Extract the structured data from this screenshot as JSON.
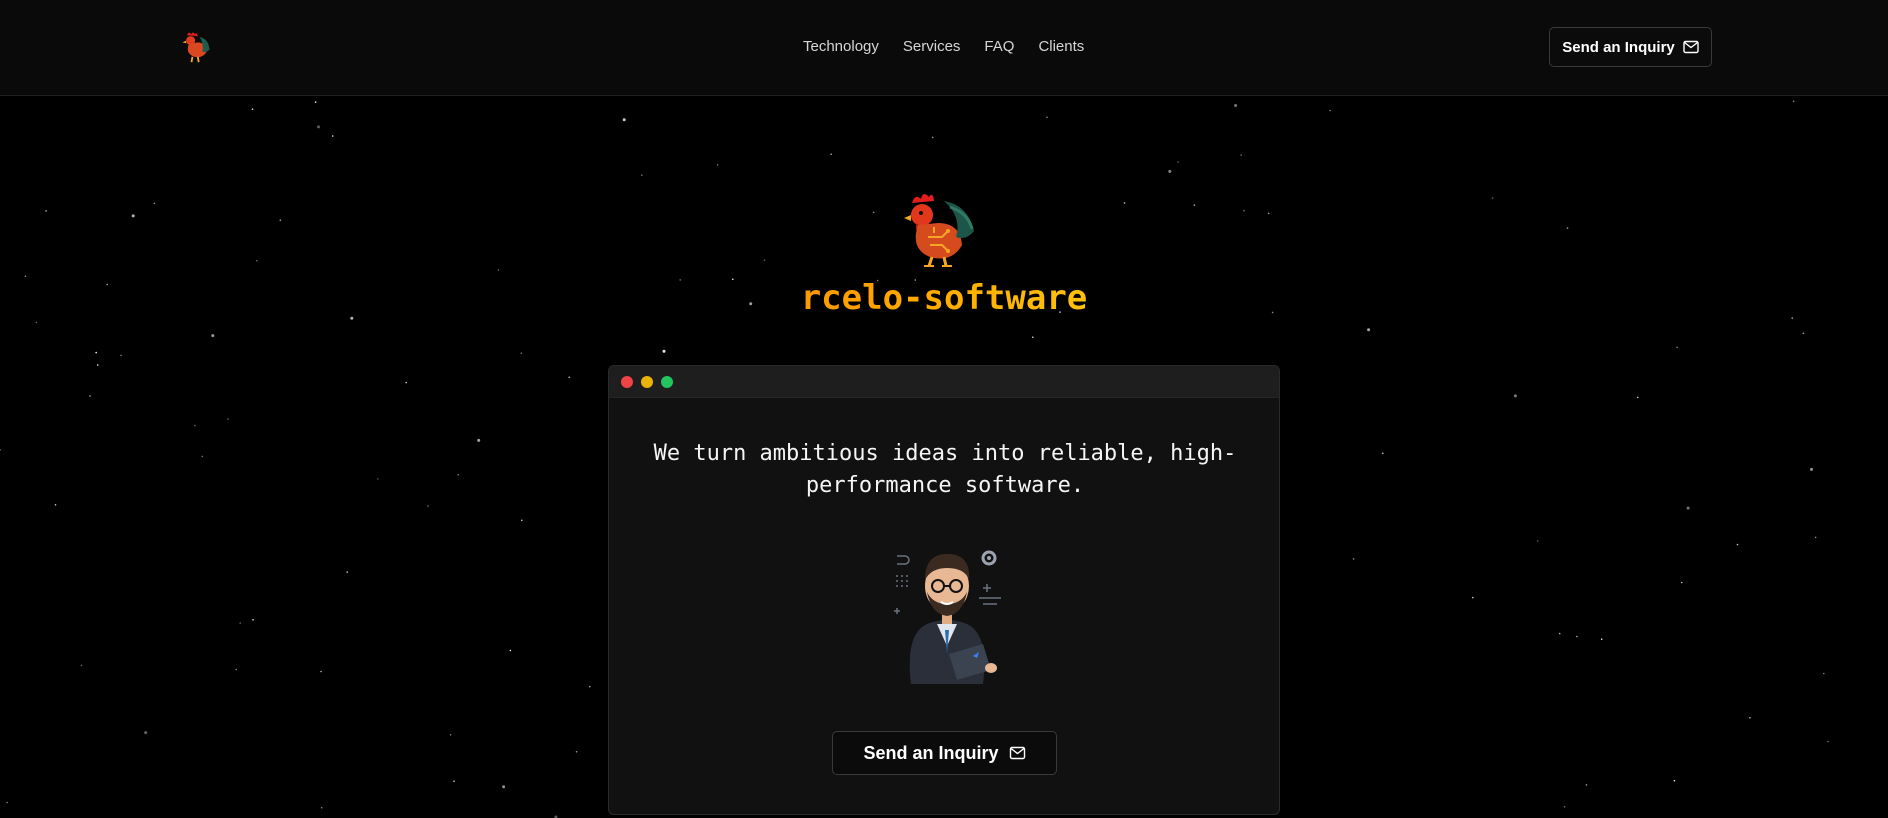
{
  "header": {
    "logo_icon": "rooster-logo-icon",
    "nav": [
      {
        "label": "Technology"
      },
      {
        "label": "Services"
      },
      {
        "label": "FAQ"
      },
      {
        "label": "Clients"
      }
    ],
    "cta_label": "Send an Inquiry",
    "cta_icon": "mail-icon"
  },
  "brand": {
    "mascot_icon": "rooster-circuit-icon",
    "name": "rcelo-software"
  },
  "hero": {
    "window_dots": [
      "#ef4444",
      "#eab308",
      "#22c55e"
    ],
    "tagline": "We turn ambitious ideas into reliable, high-performance software.",
    "illustration_icon": "developer-with-laptop-illustration",
    "cta_label": "Send an Inquiry",
    "cta_icon": "mail-icon"
  },
  "colors": {
    "background": "#000000",
    "brand_gradient_start": "#ff8a00",
    "brand_gradient_end": "#ffd11a"
  }
}
